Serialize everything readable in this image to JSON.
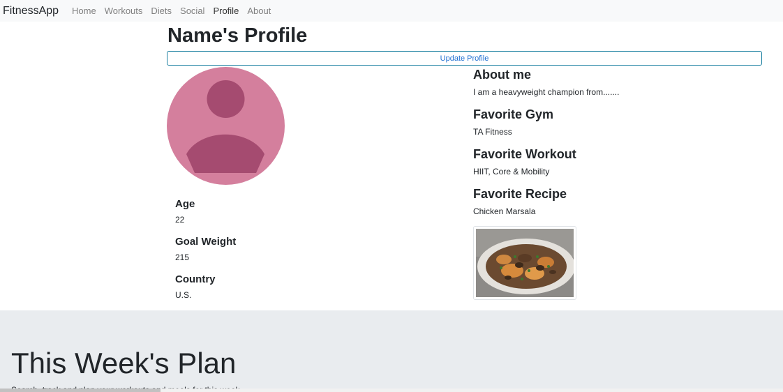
{
  "navbar": {
    "brand": "FitnessApp",
    "links": [
      "Home",
      "Workouts",
      "Diets",
      "Social",
      "Profile",
      "About"
    ],
    "active": "Profile"
  },
  "profile": {
    "title": "Name's Profile",
    "update_button": "Update Profile",
    "avatar_icon": "user-avatar-icon",
    "details": [
      {
        "label": "Age",
        "value": "22"
      },
      {
        "label": "Goal Weight",
        "value": "215"
      },
      {
        "label": "Country",
        "value": "U.S."
      }
    ],
    "sections": [
      {
        "label": "About me",
        "value": "I am a heavyweight champion from......."
      },
      {
        "label": "Favorite Gym",
        "value": "TA Fitness"
      },
      {
        "label": "Favorite Workout",
        "value": "HIIT, Core & Mobility"
      },
      {
        "label": "Favorite Recipe",
        "value": "Chicken Marsala"
      }
    ],
    "recipe_image": "chicken-marsala-photo"
  },
  "plan": {
    "title": "This Week's Plan",
    "subtitle": "Search, track and plan your workouts and meals for this week."
  },
  "colors": {
    "navbar_bg": "#f8f9fa",
    "avatar_bg": "#d47f9d",
    "avatar_fg": "#a54b70",
    "button_border": "#1a7fa0",
    "jumbotron_bg": "#e9ecef"
  }
}
